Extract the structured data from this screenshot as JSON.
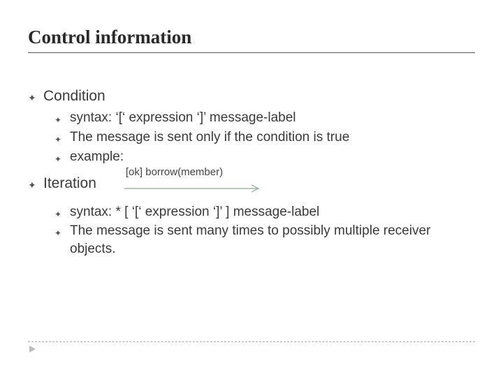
{
  "title": "Control information",
  "sections": [
    {
      "heading": "Condition",
      "items": [
        "syntax: ‘[‘ expression ‘]’ message-label",
        "The message is sent only if the condition is true",
        "example:"
      ]
    },
    {
      "heading": "Iteration",
      "items": [
        "syntax: * [ ‘[‘ expression ‘]’ ] message-label",
        "The message is sent many times to possibly multiple receiver objects."
      ]
    }
  ],
  "diagram_label": "[ok] borrow(member)",
  "bullet_glyph": "҉",
  "chart_data": {
    "type": "diagram",
    "description": "UML message arrow with guard condition",
    "label": "[ok] borrow(member)",
    "arrow_color": "#9fb89f"
  }
}
